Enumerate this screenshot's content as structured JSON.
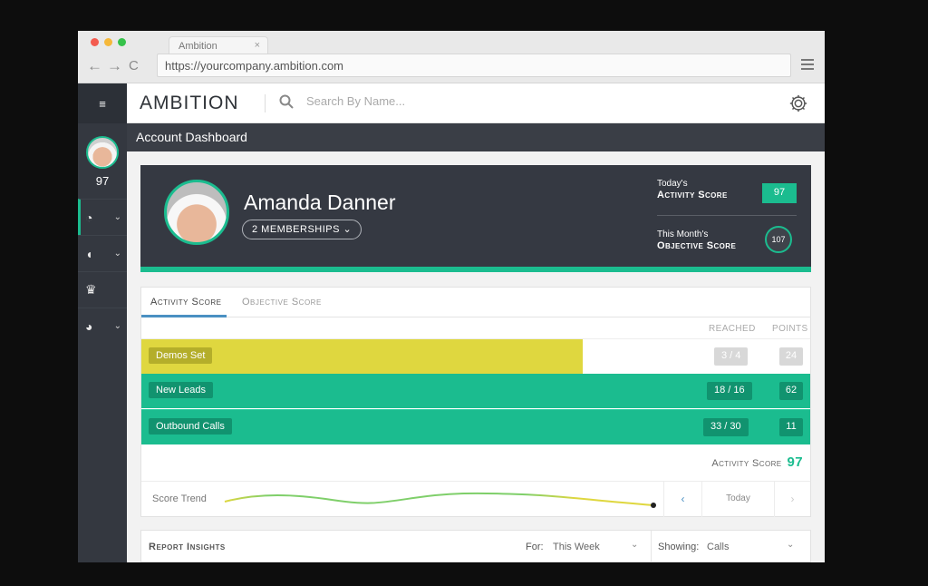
{
  "browser": {
    "tab_title": "Ambition",
    "tab_close": "×",
    "url": "https://yourcompany.ambition.com",
    "back_glyph": "←",
    "forward_glyph": "→",
    "reload_glyph": "C"
  },
  "app": {
    "logo": "AMBITION",
    "search_placeholder": "Search By Name...",
    "page_title": "Account Dashboard"
  },
  "rail": {
    "menu_glyph": "≡",
    "score": "97",
    "items": [
      {
        "icon": "speedometer-icon",
        "glyph": "◔",
        "has_chevron": true
      },
      {
        "icon": "helmet-icon",
        "glyph": "◖",
        "has_chevron": true
      },
      {
        "icon": "trophy-icon",
        "glyph": "♛",
        "has_chevron": false
      },
      {
        "icon": "pie-chart-icon",
        "glyph": "◕",
        "has_chevron": true
      }
    ],
    "chevron": "⌄"
  },
  "profile": {
    "name": "Amanda Danner",
    "memberships": "2 MEMBERSHIPS ⌄",
    "today_line1": "Today's",
    "today_line2": "Activity Score",
    "today_value": "97",
    "month_line1": "This Month's",
    "month_line2": "Objective Score",
    "month_value": "107"
  },
  "activity": {
    "tabs": [
      "Activity Score",
      "Objective Score"
    ],
    "col_reached": "REACHED",
    "col_points": "POINTS",
    "rows": [
      {
        "label": "Demos Set",
        "reached": "3 / 4",
        "points": "24",
        "progress": 0.66
      },
      {
        "label": "New Leads",
        "reached": "18 / 16",
        "points": "62",
        "progress": 1.0
      },
      {
        "label": "Outbound Calls",
        "reached": "33 / 30",
        "points": "11",
        "progress": 1.0
      }
    ],
    "activity_score_label": "Activity Score",
    "activity_score_value": "97",
    "trend_label": "Score Trend",
    "trend_today": "Today",
    "trend_prev": "‹",
    "trend_next": "›"
  },
  "report": {
    "title": "Report Insights",
    "for_label": "For:",
    "for_value": "This Week",
    "showing_label": "Showing:",
    "showing_value": "Calls",
    "chevron": "⌄"
  },
  "colors": {
    "accent_green": "#1bbc8f",
    "accent_yellow": "#dfd73f",
    "dark": "#353942"
  }
}
